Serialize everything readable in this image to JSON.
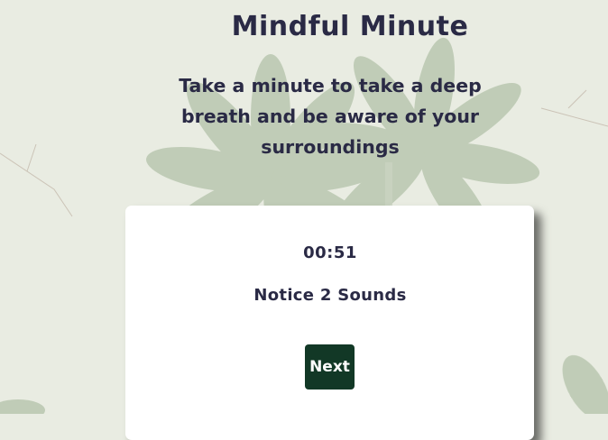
{
  "page": {
    "title": "Mindful Minute",
    "subtitle": "Take a minute to take a deep breath and be aware of your surroundings"
  },
  "card": {
    "timer": "00:51",
    "prompt": "Notice 2 Sounds",
    "next_label": "Next"
  },
  "colors": {
    "text": "#2a2a45",
    "button": "#123826",
    "background": "#e9ece2",
    "card": "#ffffff",
    "flower": "#9fb394"
  },
  "background": {
    "image": "watercolor-daisy-flowers"
  }
}
